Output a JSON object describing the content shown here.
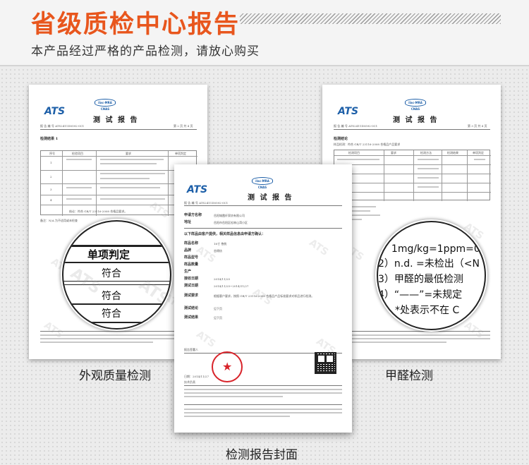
{
  "header": {
    "title": "省级质检中心报告",
    "subtitle": "本产品经过严格的产品检测，请放心购买"
  },
  "common": {
    "ats_logo": "ATS",
    "ilac_badge": "ilac-MRA  CNAS",
    "report_title": "测 试 报 告",
    "report_no": "报 告 编 号  ATS2411D0592-0C1",
    "watermark": "ATS"
  },
  "left_doc": {
    "page_no": "第 2 页 共 4 页",
    "section": "检测结果 1",
    "table_header": [
      "序号",
      "检验项目",
      "要求",
      "单项判定"
    ],
    "rows": [
      "1",
      "2",
      "3",
      "4"
    ],
    "conclusion": "结论：符合 GB/T 23116-2008 合格品要求。",
    "note": "备注：N/A 为不适用或未检查",
    "magnifier": {
      "header": "单项判定",
      "values": [
        "符合",
        "符合",
        "符合"
      ]
    },
    "caption": "外观质量检测"
  },
  "right_doc": {
    "page_no": "第 3 页 共 4 页",
    "section": "检测结论",
    "sample_line": "样品检测：符合 GB/T 23116-2008 合格品产品要求",
    "table_header": [
      "检测项目",
      "要求",
      "检测方法",
      "检测结果",
      "单项判定"
    ],
    "magnifier": {
      "lines": [
        "1）1mg/kg=1ppm=0",
        "（2）n.d. =未检出（<N",
        "（3）甲醛的最低检测",
        "（4）“——”=未规定",
        "*处表示不在 C"
      ]
    },
    "caption": "甲醛检测"
  },
  "center_doc": {
    "applicant_label": "申请方名称",
    "applicant": "岳阳城霞纤家纺有限公司",
    "address_label": "地址",
    "address": "岳阳市岳阳区松林山湾小区",
    "info_note": "以下样品由客户提供，相关样品信息由申请方确认：",
    "fields": [
      {
        "label": "样品名称",
        "value": "18寸 抱枕"
      },
      {
        "label": "品牌",
        "value": "恋绵纺"
      },
      {
        "label": "样品型号",
        "value": ""
      },
      {
        "label": "样品数量",
        "value": ""
      },
      {
        "label": "生产",
        "value": ""
      },
      {
        "label": "接收日期",
        "value": "2014/11/25"
      },
      {
        "label": "测试日期",
        "value": "2014/11/25~2014/11/27"
      },
      {
        "label": "测试要求",
        "value": "根据客户要求，按照 GB/T 23116-2008 合格品产品标准要求对样品进行检测。"
      },
      {
        "label": "测试结论",
        "value": "见下页"
      },
      {
        "label": "测试结果",
        "value": "见下页"
      }
    ],
    "signer_label": "报告签署人",
    "date_label": "日期：2014/11/27",
    "tech_label": "技术负责",
    "caption": "检测报告封面"
  }
}
